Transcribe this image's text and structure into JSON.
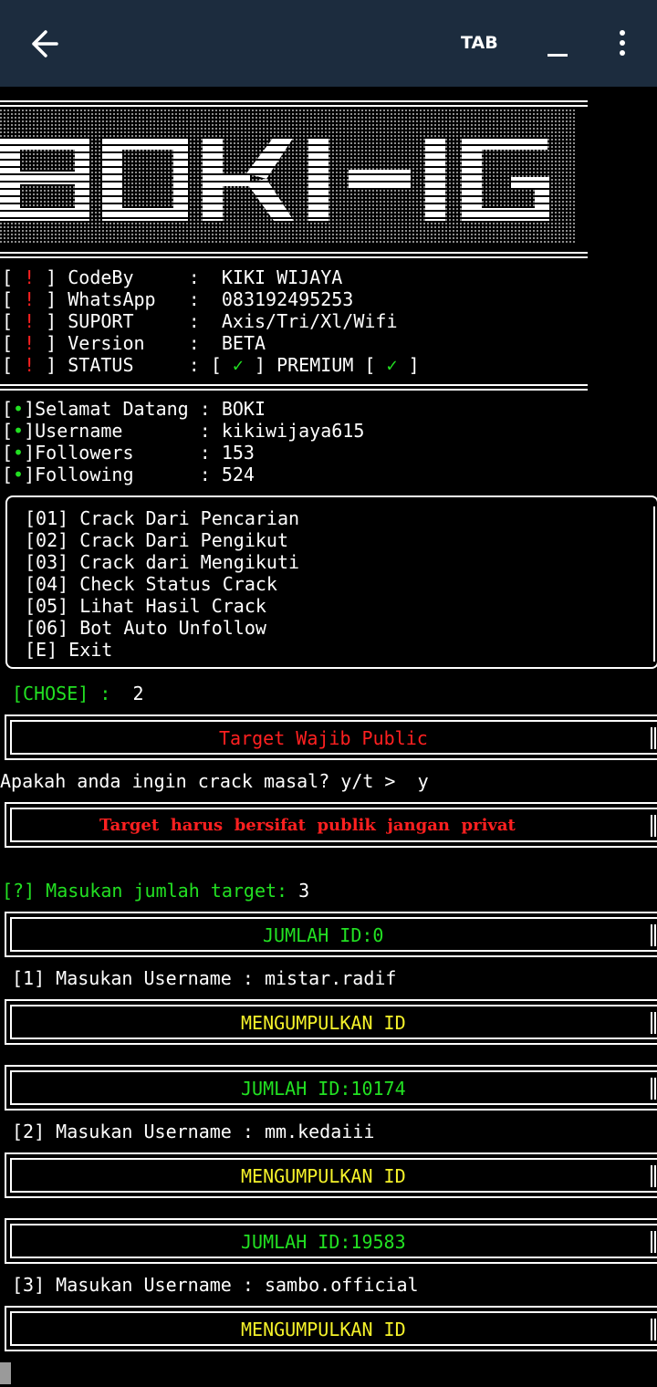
{
  "header": {
    "tab_label": "TAB"
  },
  "banner": {
    "logo_text": "BOKI-IG"
  },
  "info": [
    {
      "mark": "!",
      "key": "CodeBy   ",
      "value": "KIKI WIJAYA"
    },
    {
      "mark": "!",
      "key": "WhatsApp ",
      "value": "083192495253"
    },
    {
      "mark": "!",
      "key": "SUPORT   ",
      "value": "Axis/Tri/Xl/Wifi"
    },
    {
      "mark": "!",
      "key": "Version  ",
      "value": "BETA"
    },
    {
      "mark": "!",
      "key": "STATUS   ",
      "value_pre": ":",
      "check1": "✓",
      "premium": "PREMIUM",
      "check2": "✓"
    }
  ],
  "status_colors": {
    "accent_red": "#ff2020",
    "accent_green": "#22e022",
    "accent_yellow": "#f5f22a",
    "appbar": "#1c2c3e"
  },
  "account": [
    {
      "bullet": "•",
      "key": "Selamat Datang",
      "value": "BOKI"
    },
    {
      "bullet": "•",
      "key": "Username      ",
      "value": "kikiwijaya615"
    },
    {
      "bullet": "•",
      "key": "Followers     ",
      "value": "153"
    },
    {
      "bullet": "•",
      "key": "Following     ",
      "value": "524"
    }
  ],
  "menu": [
    "[01] Crack Dari Pencarian",
    "[02] Crack Dari Pengikut",
    "[03] Crack dari Mengikuti",
    "[04] Check Status Crack",
    "[05] Lihat Hasil Crack",
    "[06] Bot Auto Unfollow",
    "[E] Exit"
  ],
  "chose": {
    "label": "[CHOSE] :",
    "value": "2"
  },
  "notice1": "Target Wajib Public",
  "prompt_masal": {
    "text": "Apakah anda ingin crack masal? y/t >",
    "value": "y"
  },
  "notice2": "Target  harus  bersifat  publik  jangan  privat",
  "jumlah_prompt": {
    "label": "[?] Masukan jumlah target:",
    "value": "3"
  },
  "jumlah0": "JUMLAH ID:0",
  "targets": [
    {
      "prompt": "[1] Masukan Username :",
      "value": "mistar.radif",
      "collect": "MENGUMPULKAN ID",
      "jumlah": "JUMLAH ID:10174"
    },
    {
      "prompt": "[2] Masukan Username :",
      "value": "mm.kedaiii",
      "collect": "MENGUMPULKAN ID",
      "jumlah": "JUMLAH ID:19583"
    },
    {
      "prompt": "[3] Masukan Username :",
      "value": "sambo.official",
      "collect": "MENGUMPULKAN ID"
    }
  ]
}
